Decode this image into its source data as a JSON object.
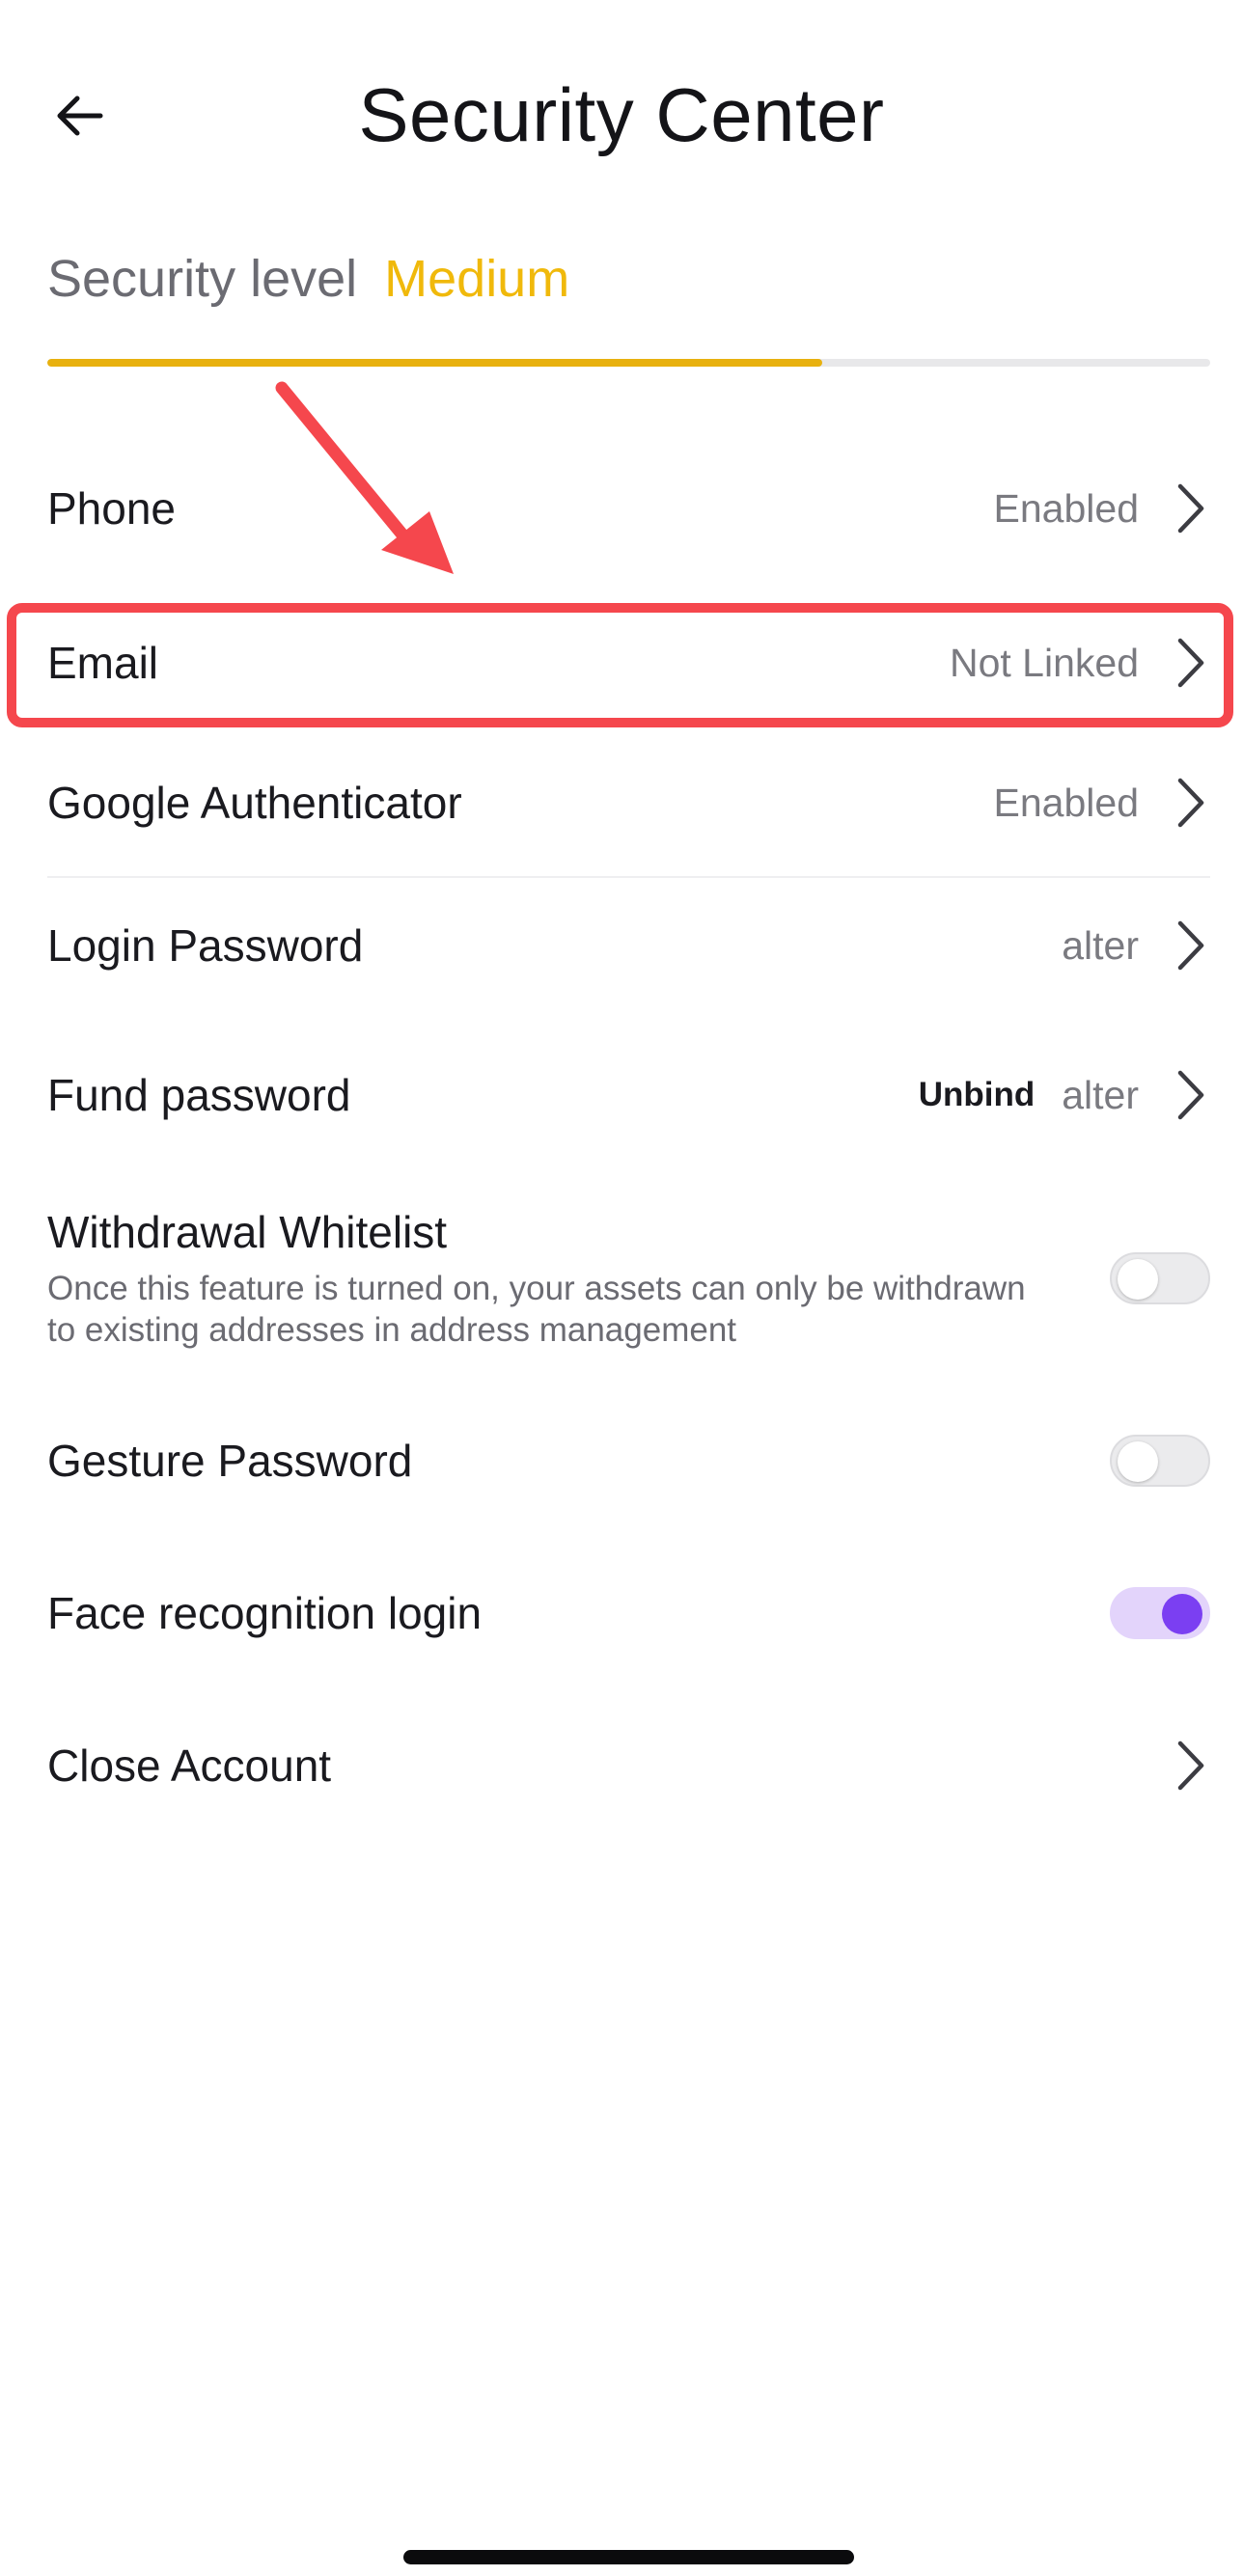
{
  "header": {
    "title": "Security Center",
    "back_icon": "arrow-left-icon"
  },
  "security": {
    "label": "Security level",
    "value": "Medium",
    "progress_fraction": 0.666,
    "accent_color": "#f0b90b"
  },
  "rows": {
    "phone": {
      "title": "Phone",
      "value": "Enabled"
    },
    "email": {
      "title": "Email",
      "value": "Not Linked"
    },
    "google_auth": {
      "title": "Google Authenticator",
      "value": "Enabled"
    },
    "login_password": {
      "title": "Login Password",
      "value": "alter"
    },
    "fund_password": {
      "title": "Fund password",
      "extra": "Unbind",
      "value": "alter"
    },
    "withdrawal_whitelist": {
      "title": "Withdrawal Whitelist",
      "description": "Once this feature is turned on, your assets can only be withdrawn to existing addresses in address management",
      "enabled": false
    },
    "gesture_password": {
      "title": "Gesture Password",
      "enabled": false
    },
    "face_login": {
      "title": "Face recognition login",
      "enabled": true
    },
    "close_account": {
      "title": "Close Account"
    }
  },
  "annotation": {
    "highlight_color": "#f5474d"
  }
}
